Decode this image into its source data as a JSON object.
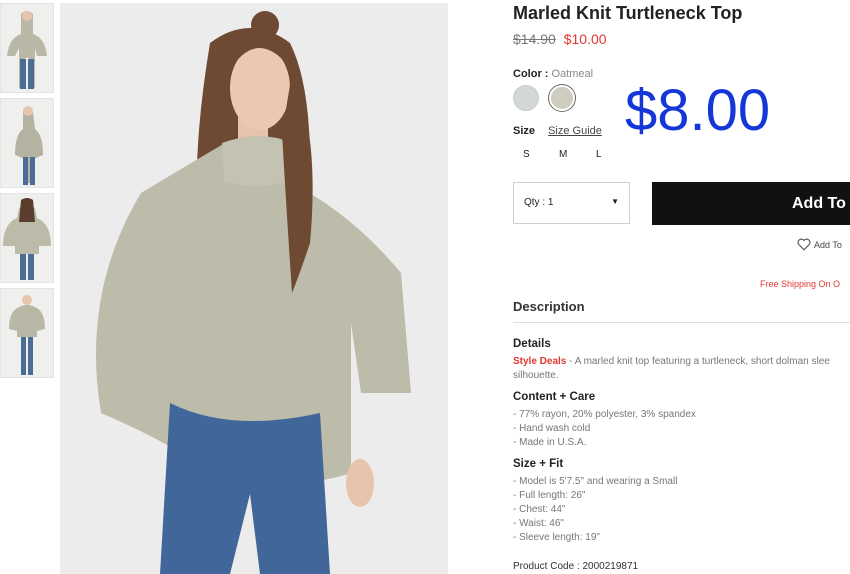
{
  "product": {
    "title": "Marled Knit Turtleneck Top",
    "price_original": "$14.90",
    "price_sale": "$10.00",
    "overlay_price": "$8.00"
  },
  "color": {
    "label": "Color :",
    "selected": "Oatmeal",
    "swatches": [
      "#d4d7d7",
      "#cfccc0"
    ]
  },
  "size": {
    "label": "Size",
    "guide": "Size Guide",
    "options": [
      "S",
      "M",
      "L"
    ]
  },
  "qty": {
    "label": "Qty : 1",
    "caret": "▼"
  },
  "actions": {
    "add_to_bag": "Add To",
    "wishlist": "Add To"
  },
  "shipping": "Free Shipping On O",
  "description": {
    "heading": "Description",
    "details_title": "Details",
    "details_highlight": "Style Deals",
    "details_text": " - A marled knit top featuring a turtleneck, short dolman slee",
    "details_text_2": "silhouette.",
    "content_title": "Content + Care",
    "content_lines": [
      "- 77% rayon, 20% polyester, 3% spandex",
      "- Hand wash cold",
      "- Made in U.S.A."
    ],
    "size_fit_title": "Size + Fit",
    "size_fit_lines": [
      "- Model is 5'7.5\" and wearing a Small",
      "- Full length: 26\"",
      "- Chest: 44\"",
      "- Waist: 46\"",
      "- Sleeve length: 19\""
    ],
    "product_code": "Product Code : 2000219871"
  },
  "colors": {
    "sale": "#e2372f",
    "overlay": "#1536d8",
    "button": "#111111"
  }
}
